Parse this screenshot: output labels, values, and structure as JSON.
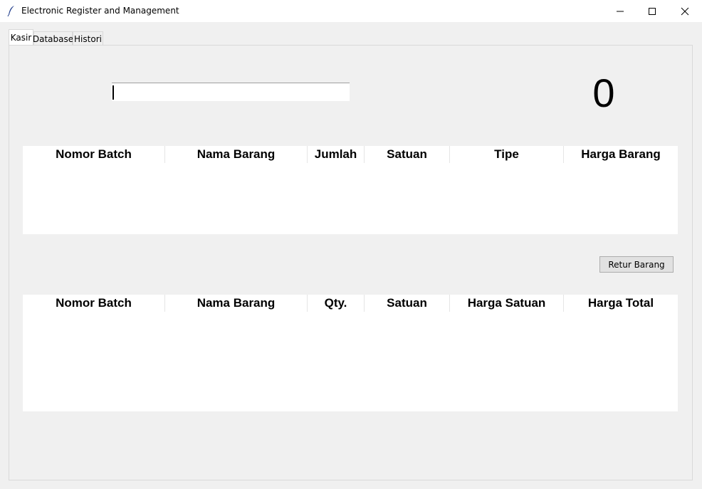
{
  "window": {
    "title": "Electronic Register and Management"
  },
  "tabs": [
    {
      "label": "Kasir",
      "active": true
    },
    {
      "label": "Database",
      "active": false
    },
    {
      "label": "Histori",
      "active": false
    }
  ],
  "kasir": {
    "scan_input_value": "",
    "total_display": "0",
    "items_table": {
      "columns": [
        "Nomor Batch",
        "Nama Barang",
        "Jumlah",
        "Satuan",
        "Tipe",
        "Harga Barang"
      ],
      "rows": []
    },
    "retur_button_label": "Retur Barang",
    "cart_table": {
      "columns": [
        "Nomor Batch",
        "Nama Barang",
        "Qty.",
        "Satuan",
        "Harga Satuan",
        "Harga Total"
      ],
      "rows": []
    }
  }
}
